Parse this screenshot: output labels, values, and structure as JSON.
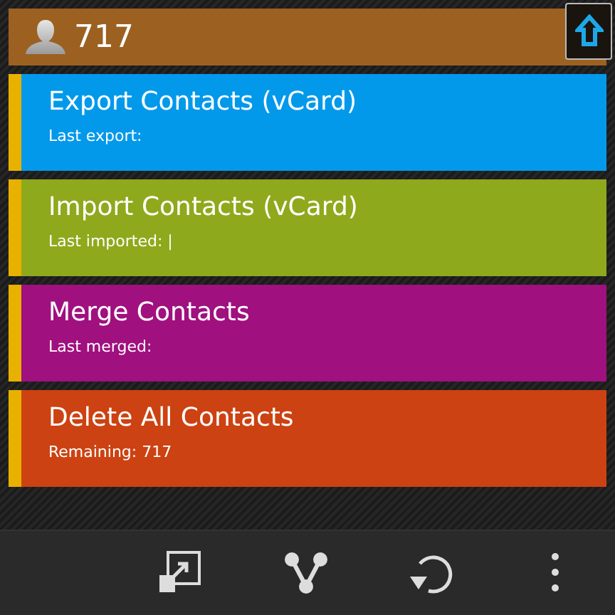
{
  "header": {
    "count": "717"
  },
  "actions": [
    {
      "title": "Export Contacts (vCard)",
      "detail": "Last export:",
      "color": "#0399eb"
    },
    {
      "title": "Import Contacts (vCard)",
      "detail": "Last imported: |",
      "color": "#8ea91c"
    },
    {
      "title": "Merge Contacts",
      "detail": "Last merged:",
      "color": "#a0107f"
    },
    {
      "title": "Delete All Contacts",
      "detail": "Remaining: 717",
      "color": "#cc4212"
    }
  ],
  "action_bar": {
    "items": [
      {
        "kind": "resize"
      },
      {
        "kind": "merge"
      },
      {
        "kind": "refresh"
      },
      {
        "kind": "more"
      }
    ]
  }
}
